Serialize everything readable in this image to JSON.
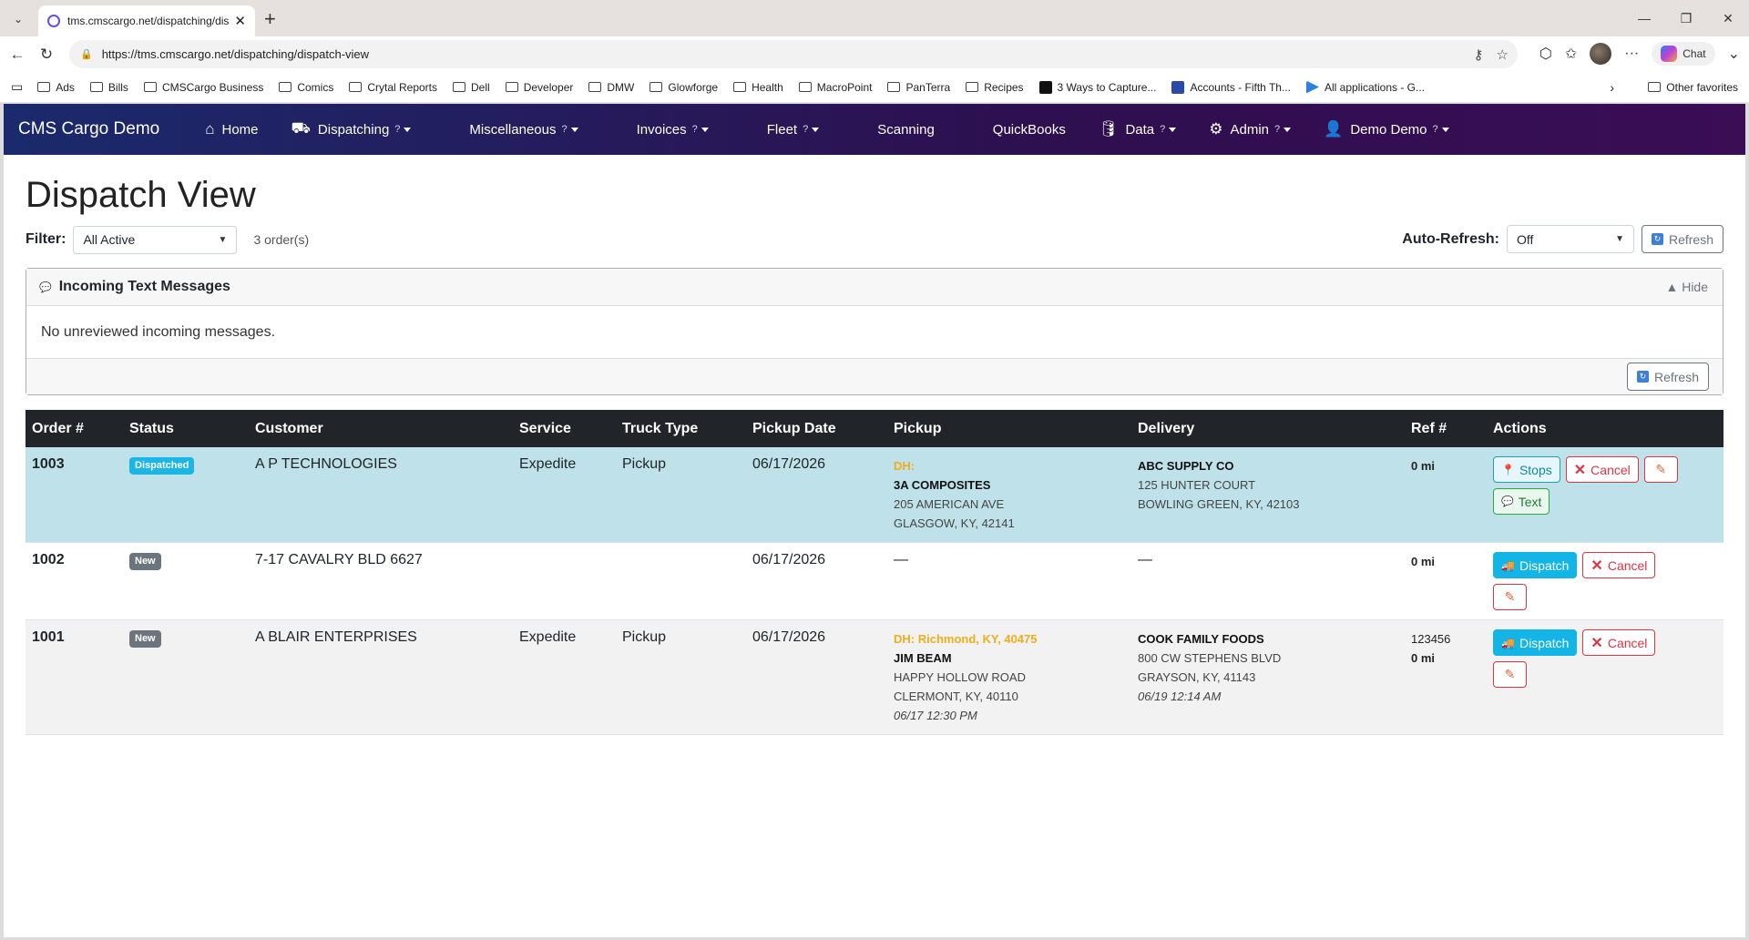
{
  "browser": {
    "tab_title": "tms.cmscargo.net/dispatching/disp",
    "url": "https://tms.cmscargo.net/dispatching/dispatch-view",
    "chat_label": "Chat",
    "favorites": [
      "Ads",
      "Bills",
      "CMSCargo Business",
      "Comics",
      "Crytal Reports",
      "Dell",
      "Developer",
      "DMW",
      "Glowforge",
      "Health",
      "MacroPoint",
      "PanTerra",
      "Recipes"
    ],
    "favorites_special": [
      "3 Ways to Capture...",
      "Accounts - Fifth Th...",
      "All applications - G..."
    ],
    "other_favorites": "Other favorites"
  },
  "nav": {
    "brand": "CMS Cargo Demo",
    "items": [
      {
        "label": "Home",
        "icon": "home-icon",
        "q": ""
      },
      {
        "label": "Dispatching",
        "icon": "truck-icon",
        "q": "?"
      },
      {
        "label": "Miscellaneous",
        "icon": "",
        "q": "?"
      },
      {
        "label": "Invoices",
        "icon": "",
        "q": "?"
      },
      {
        "label": "Fleet",
        "icon": "",
        "q": "?"
      },
      {
        "label": "Scanning",
        "icon": "",
        "q": ""
      },
      {
        "label": "QuickBooks",
        "icon": "",
        "q": ""
      },
      {
        "label": "Data",
        "icon": "database-icon",
        "q": "?"
      },
      {
        "label": "Admin",
        "icon": "gear-icon",
        "q": "?"
      },
      {
        "label": "Demo Demo",
        "icon": "user-icon",
        "q": "?"
      }
    ]
  },
  "page": {
    "title": "Dispatch View",
    "filter_label": "Filter:",
    "filter_value": "All Active",
    "order_count": "3 order(s)",
    "autorefresh_label": "Auto-Refresh:",
    "autorefresh_value": "Off",
    "refresh_label": "Refresh"
  },
  "messages": {
    "title": "Incoming Text Messages",
    "hide_label": "Hide",
    "body": "No unreviewed incoming messages.",
    "refresh_label": "Refresh"
  },
  "table": {
    "headers": [
      "Order #",
      "Status",
      "Customer",
      "Service",
      "Truck Type",
      "Pickup Date",
      "Pickup",
      "Delivery",
      "Ref #",
      "Actions"
    ],
    "rows": [
      {
        "order": "1003",
        "status": "Dispatched",
        "customer": "A P TECHNOLOGIES",
        "service": "Expedite",
        "truck": "Pickup",
        "date": "06/17/2026",
        "pickup": {
          "dh": "DH:",
          "name": "3A COMPOSITES",
          "line1": "205 AMERICAN AVE",
          "line2": "GLASGOW, KY, 42141",
          "time": ""
        },
        "delivery": {
          "name": "ABC SUPPLY CO",
          "line1": "125 HUNTER COURT",
          "line2": "BOWLING GREEN, KY, 42103",
          "time": ""
        },
        "ref": "",
        "miles": "0 mi",
        "actions": {
          "primary": "Stops",
          "cancel": "Cancel",
          "secondary": "Text"
        }
      },
      {
        "order": "1002",
        "status": "New",
        "customer": "7-17 CAVALRY BLD 6627",
        "service": "",
        "truck": "",
        "date": "06/17/2026",
        "pickup_dash": "—",
        "delivery_dash": "—",
        "ref": "",
        "miles": "0 mi",
        "actions": {
          "primary": "Dispatch",
          "cancel": "Cancel"
        }
      },
      {
        "order": "1001",
        "status": "New",
        "customer": "A BLAIR ENTERPRISES",
        "service": "Expedite",
        "truck": "Pickup",
        "date": "06/17/2026",
        "pickup": {
          "dh": "DH: Richmond, KY, 40475",
          "name": "JIM BEAM",
          "line1": "HAPPY HOLLOW ROAD",
          "line2": "CLERMONT, KY, 40110",
          "time": "06/17 12:30 PM"
        },
        "delivery": {
          "name": "COOK FAMILY FOODS",
          "line1": "800 CW STEPHENS BLVD",
          "line2": "GRAYSON, KY, 41143",
          "time": "06/19 12:14 AM"
        },
        "ref": "123456",
        "miles": "0 mi",
        "actions": {
          "primary": "Dispatch",
          "cancel": "Cancel"
        }
      }
    ]
  }
}
